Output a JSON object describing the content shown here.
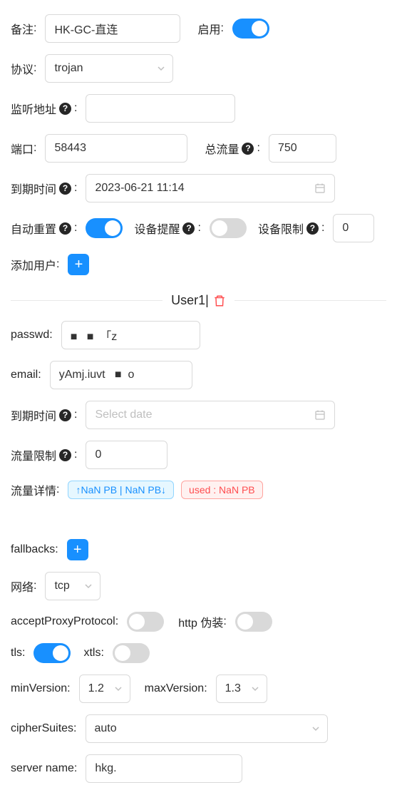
{
  "labels": {
    "remark": "备注",
    "enable": "启用",
    "protocol": "协议",
    "listen": "监听地址",
    "port": "端口",
    "totalTraffic": "总流量",
    "expire": "到期时间",
    "autoReset": "自动重置",
    "deviceNotify": "设备提醒",
    "deviceLimit": "设备限制",
    "addUser": "添加用户",
    "passwd": "passwd",
    "email": "email",
    "trafficLimit": "流量限制",
    "trafficDetail": "流量详情",
    "fallbacks": "fallbacks",
    "network": "网络",
    "acceptProxy": "acceptProxyProtocol",
    "httpMasq": "http 伪装",
    "tls": "tls",
    "xtls": "xtls",
    "minVersion": "minVersion",
    "maxVersion": "maxVersion",
    "cipherSuites": "cipherSuites",
    "serverName": "server name"
  },
  "placeholders": {
    "selectDate": "Select date"
  },
  "values": {
    "remark": "HK-GC-直连",
    "protocol": "trojan",
    "listen": "",
    "port": "58443",
    "totalTraffic": "750",
    "expire": "2023-06-21 11:14",
    "deviceLimit": "0",
    "network": "tcp",
    "minVersion": "1.2",
    "maxVersion": "1.3",
    "cipherSuites": "auto",
    "serverName": "hkg."
  },
  "toggles": {
    "enable": true,
    "autoReset": true,
    "deviceNotify": false,
    "acceptProxy": false,
    "httpMasq": false,
    "tls": true,
    "xtls": false
  },
  "user": {
    "title": "User1|",
    "passwd": "■   ■  「z",
    "email": "yAmj.iuvt   ■  o",
    "expire": "",
    "trafficLimit": "0"
  },
  "tags": {
    "updown": "↑NaN PB | NaN PB↓",
    "used": "used : NaN PB"
  }
}
